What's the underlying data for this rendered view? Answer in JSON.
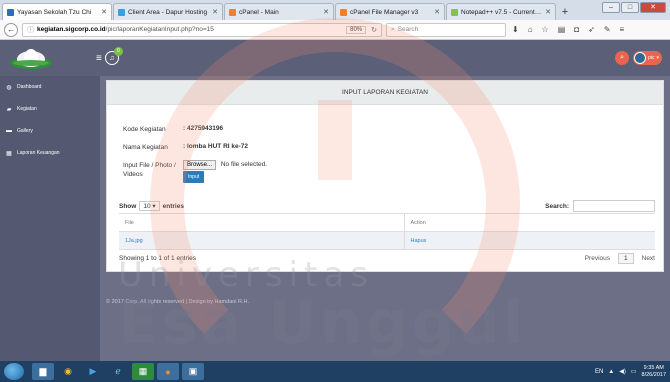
{
  "browser": {
    "tabs": [
      {
        "label": "Yayasan Sekolah Tzu Chi",
        "color": "#2b6fb5",
        "active": true
      },
      {
        "label": "Client Area - Dapur Hosting",
        "color": "#3aa0d8",
        "active": false
      },
      {
        "label": "cPanel - Main",
        "color": "#f08030",
        "active": false
      },
      {
        "label": "cPanel File Manager v3",
        "color": "#f08030",
        "active": false
      },
      {
        "label": "Notepad++ v7.5 - Current V...",
        "color": "#8ac04a",
        "active": false
      }
    ],
    "url_host": "kegiatan.sigcorp.co.id",
    "url_path": "/pic/laporanKegiatanInput.php?no=15",
    "zoom": "80%",
    "search_placeholder": "Search"
  },
  "header": {
    "notification_count": "0",
    "user_label": "pic"
  },
  "sidebar": {
    "items": [
      {
        "label": "Dashboard",
        "icon": "dashboard-icon"
      },
      {
        "label": "Kegiatan",
        "icon": "book-icon"
      },
      {
        "label": "Gallery",
        "icon": "image-icon"
      },
      {
        "label": "Laporan Keuangan",
        "icon": "table-icon"
      }
    ]
  },
  "card": {
    "title": "INPUT LAPORAN KEGIATAN",
    "kode_label": "Kode Kegiatan",
    "kode_value": ": 4275943196",
    "nama_label": "Nama Kegiatan",
    "nama_value": ": lomba HUT RI ke-72",
    "file_label": "Input File / Photo / Videos",
    "browse_label": "Browse...",
    "no_file": "No file selected.",
    "input_button": "Input"
  },
  "table": {
    "show_label": "Show",
    "entries_value": "10",
    "entries_label": "entries",
    "search_label": "Search:",
    "columns": [
      "File",
      "Action"
    ],
    "rows": [
      {
        "file": "1Ja.jpg",
        "action": "Hapus"
      }
    ],
    "info": "Showing 1 to 1 of 1 entries",
    "prev": "Previous",
    "page": "1",
    "next": "Next"
  },
  "footer": {
    "text": "© 2017 Corp. All rights reserved | Design by Hamdani R.H."
  },
  "watermark": {
    "line1": "Universitas",
    "line2": "Esa Unggul"
  },
  "taskbar": {
    "lang": "EN",
    "time": "9:35 AM",
    "date": "8/26/2017"
  },
  "colors": {
    "header": "#5b5f78",
    "sidebar": "#545871",
    "accent": "#e8654f",
    "button": "#2b7bb9"
  }
}
